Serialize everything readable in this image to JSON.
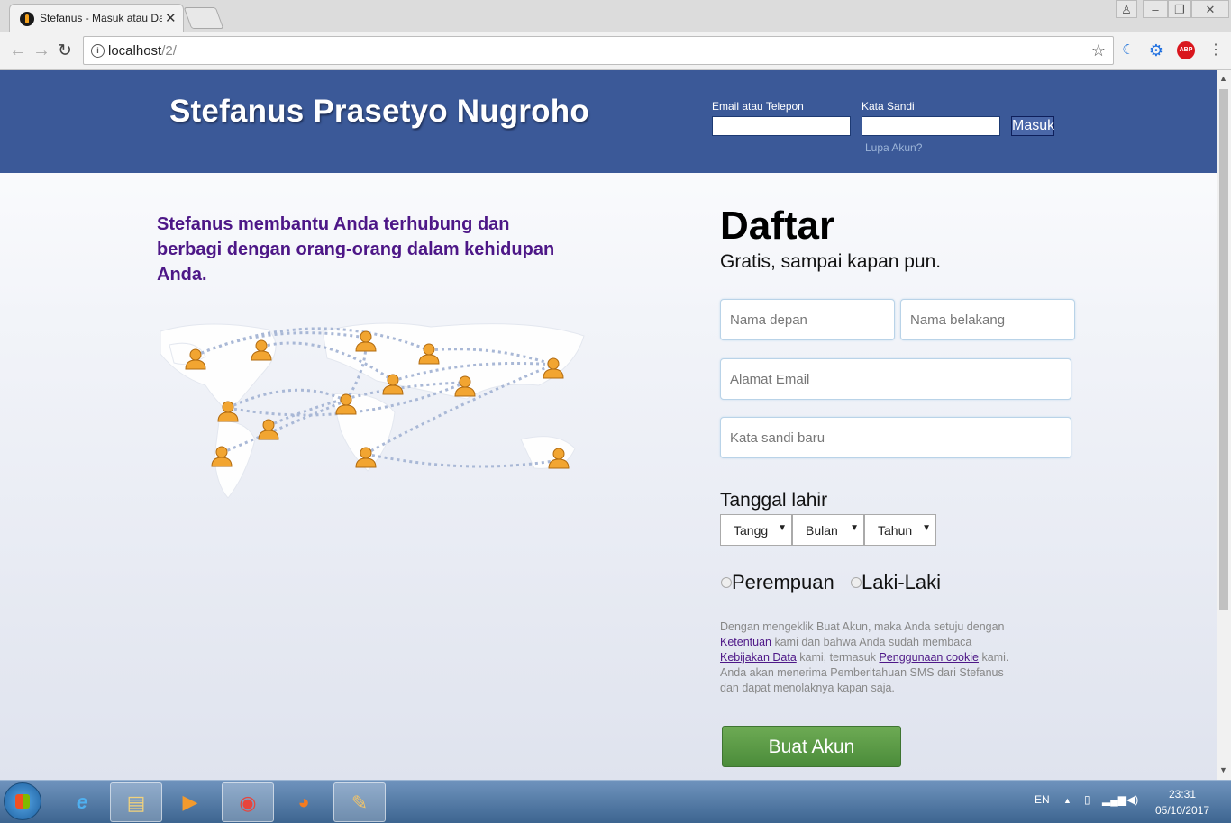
{
  "browser": {
    "tab_title": "Stefanus - Masuk atau Da",
    "url_host": "localhost",
    "url_path": "/2/"
  },
  "header": {
    "logo": "Stefanus Prasetyo Nugroho",
    "email_label": "Email atau Telepon",
    "password_label": "Kata Sandi",
    "login_button": "Masuk",
    "forgot": "Lupa Akun?"
  },
  "left": {
    "tagline": "Stefanus membantu Anda terhubung dan berbagi dengan orang-orang dalam kehidupan Anda."
  },
  "signup": {
    "title": "Daftar",
    "subtitle": "Gratis, sampai kapan pun.",
    "first_name_placeholder": "Nama depan",
    "last_name_placeholder": "Nama belakang",
    "email_placeholder": "Alamat Email",
    "password_placeholder": "Kata sandi baru",
    "dob_label": "Tanggal lahir",
    "dob_day": "Tangg",
    "dob_month": "Bulan",
    "dob_year": "Tahun",
    "gender_female": "Perempuan",
    "gender_male": "Laki-Laki",
    "terms": {
      "t1": "Dengan mengeklik Buat Akun, maka Anda setuju dengan ",
      "l1": "Ketentuan",
      "t2": " kami dan bahwa Anda sudah membaca ",
      "l2": "Kebijakan Data",
      "t3": " kami, termasuk ",
      "l3": "Penggunaan cookie",
      "t4": " kami. Anda akan menerima Pemberitahuan SMS dari Stefanus dan dapat menolaknya kapan saja."
    },
    "submit": "Buat Akun"
  },
  "taskbar": {
    "language": "EN",
    "time": "23:31",
    "date": "05/10/2017"
  }
}
